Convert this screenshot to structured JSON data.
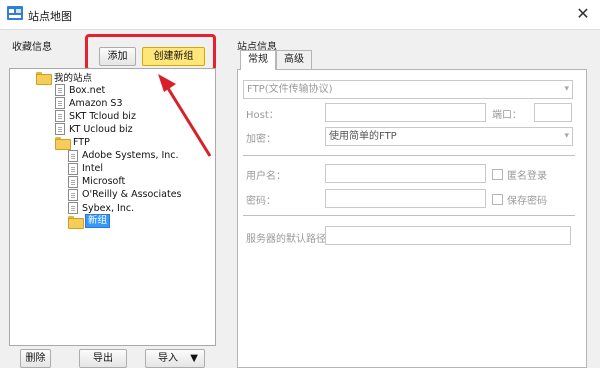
{
  "window": {
    "title": "站点地图",
    "close_glyph": "✕"
  },
  "favorites": {
    "section_label": "收藏信息",
    "add_button": "添加",
    "create_group_button": "创建新组",
    "tree": [
      {
        "label": "我的站点",
        "kind": "folder",
        "level": 0
      },
      {
        "label": "Box.net",
        "kind": "site",
        "level": 1
      },
      {
        "label": "Amazon S3",
        "kind": "site",
        "level": 1
      },
      {
        "label": "SKT Tcloud biz",
        "kind": "site",
        "level": 1
      },
      {
        "label": "KT Ucloud biz",
        "kind": "site",
        "level": 1
      },
      {
        "label": "FTP",
        "kind": "folder",
        "level": 1
      },
      {
        "label": "Adobe Systems, Inc.",
        "kind": "site",
        "level": 2
      },
      {
        "label": "Intel",
        "kind": "site",
        "level": 2
      },
      {
        "label": "Microsoft",
        "kind": "site",
        "level": 2
      },
      {
        "label": "O'Reilly & Associates",
        "kind": "site",
        "level": 2
      },
      {
        "label": "Sybex, Inc.",
        "kind": "site",
        "level": 2
      },
      {
        "label": "新组",
        "kind": "folder",
        "level": 2,
        "editing": true
      }
    ],
    "delete_button": "删除",
    "export_button": "导出",
    "import_button": "导入"
  },
  "site_info": {
    "section_label": "站点信息",
    "tabs": [
      "常规",
      "高级"
    ],
    "active_tab": 0,
    "protocol_value": "FTP(文件传输协议)",
    "host_label": "Host：",
    "port_label": "端口：",
    "encryption_label": "加密：",
    "encryption_value": "使用简单的FTP",
    "username_label": "用户名：",
    "anonymous_label": "匿名登录",
    "password_label": "密码：",
    "save_password_label": "保存密码",
    "default_path_label": "服务器的默认路径"
  },
  "colors": {
    "highlight": "#e5202f",
    "accent_button": "#ffe67a",
    "folder": "#f5cd5b"
  }
}
